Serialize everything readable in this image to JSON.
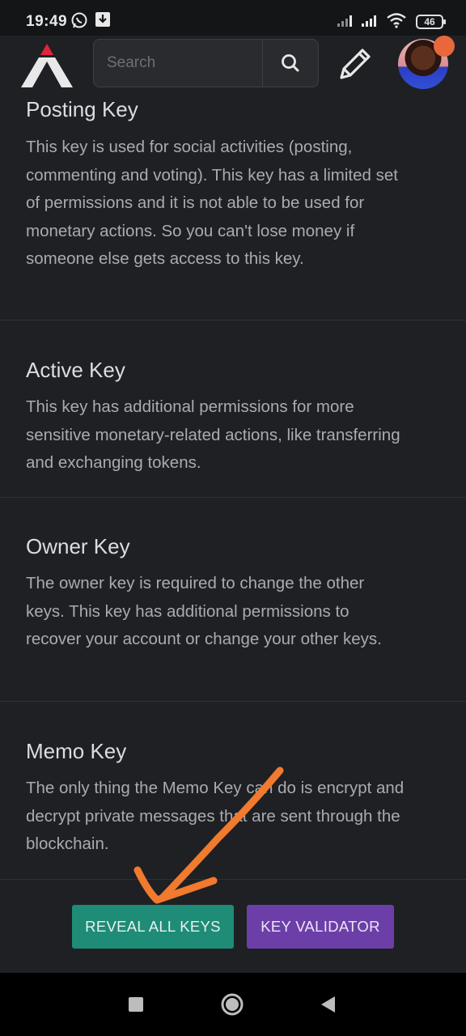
{
  "status_bar": {
    "time": "19:49",
    "battery": "46",
    "icons": [
      "whatsapp-icon",
      "download-icon",
      "signal-icon",
      "signal-icon",
      "wifi-icon",
      "battery-icon"
    ]
  },
  "header": {
    "search_placeholder": "Search",
    "icons": [
      "app-logo-icon",
      "search-icon",
      "pencil-icon",
      "avatar",
      "notification-dot"
    ]
  },
  "sections": [
    {
      "title": "Posting Key",
      "description": "This key is used for social activities (posting, commenting and voting). This key has a limited set of permissions and it is not able to be used for monetary actions. So you can't lose money if someone else gets access to this key."
    },
    {
      "title": "Active Key",
      "description": "This key has additional permissions for more sensitive monetary-related actions, like transferring and exchanging tokens."
    },
    {
      "title": "Owner Key",
      "description": "The owner key is required to change the other keys. This key has additional permissions to recover your account or change your other keys."
    },
    {
      "title": "Memo Key",
      "description": "The only thing the Memo Key can do is encrypt and decrypt private messages that are sent through the blockchain."
    }
  ],
  "buttons": {
    "reveal": "REVEAL ALL KEYS",
    "validator": "KEY VALIDATOR"
  },
  "colors": {
    "background": "#1f2023",
    "reveal_button": "#1e8c77",
    "validator_button": "#6c3fa8",
    "annotation_arrow": "#f07a2e"
  },
  "navbar": {
    "icons": [
      "recents-square-icon",
      "home-circle-icon",
      "back-triangle-icon"
    ]
  }
}
